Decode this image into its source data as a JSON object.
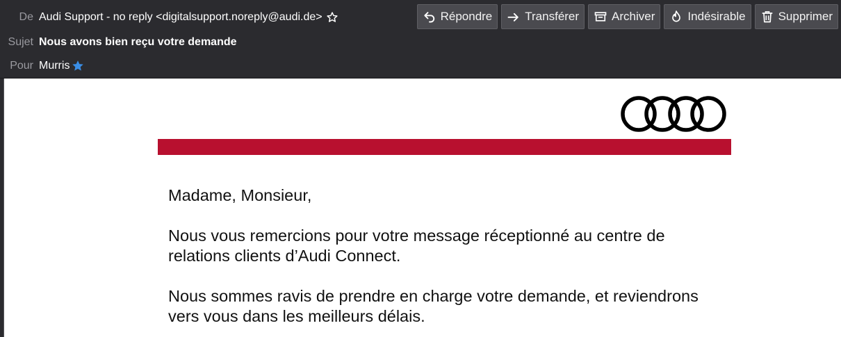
{
  "header": {
    "from_label": "De",
    "from_value": "Audi Support - no reply <digitalsupport.noreply@audi.de>",
    "subject_label": "Sujet",
    "subject_value": "Nous avons bien reçu votre demande",
    "to_label": "Pour",
    "to_value": "Murris",
    "background_color": "#2b2b2f"
  },
  "toolbar": {
    "reply_label": "Répondre",
    "forward_label": "Transférer",
    "archive_label": "Archiver",
    "junk_label": "Indésirable",
    "delete_label": "Supprimer"
  },
  "icons": {
    "star": "star-outline-icon",
    "verified": "blue-star-icon",
    "reply": "reply-arrow-icon",
    "forward": "forward-arrow-icon",
    "archive": "archive-box-icon",
    "junk": "flame-icon",
    "delete": "trash-icon",
    "logo": "audi-rings-logo"
  },
  "email": {
    "greeting": "Madame, Monsieur,",
    "paragraph1": "Nous vous remercions pour votre message réceptionné au centre de relations clients d’Audi Connect.",
    "paragraph2": "Nous sommes ravis de prendre en charge votre demande, et reviendrons vers vous dans les meilleurs délais.",
    "accent_color": "#b8102f"
  }
}
